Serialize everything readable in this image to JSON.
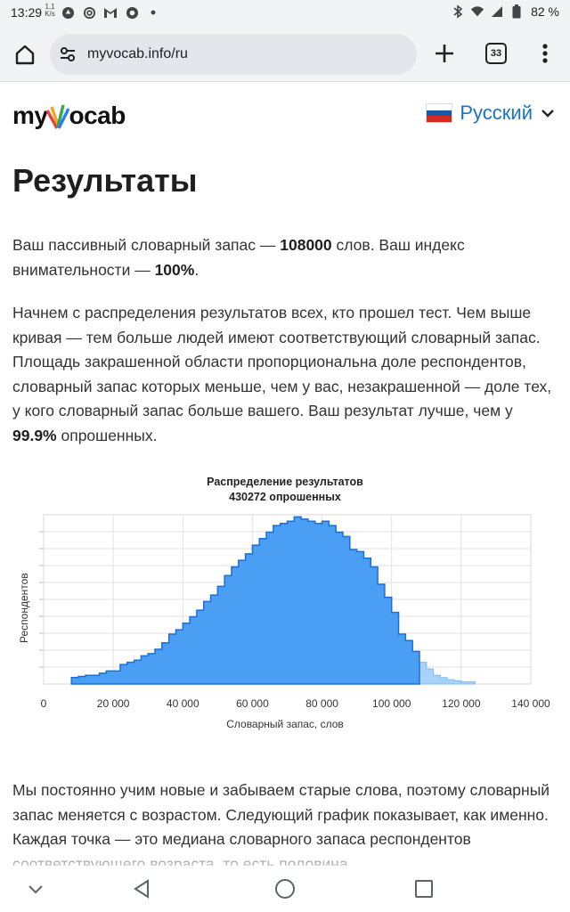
{
  "status_bar": {
    "time": "13:29",
    "speed_value": "1,1",
    "speed_unit": "K/s",
    "battery": "82 %",
    "icons": [
      "notification-icon",
      "at-icon",
      "gmail-icon",
      "chrome-icon",
      "dot-icon",
      "bluetooth-icon",
      "wifi-icon",
      "signal-icon",
      "battery-icon"
    ]
  },
  "browser": {
    "url": "myvocab.info/ru",
    "tab_count": "33"
  },
  "header": {
    "logo_prefix": "my",
    "logo_suffix": "ocab",
    "language": "Русский"
  },
  "page": {
    "title": "Результаты",
    "p1": {
      "t1": "Ваш пассивный словарный запас — ",
      "vocab": "108000",
      "t2": " слов. Ваш индекс внимательности — ",
      "attention": "100%",
      "t3": "."
    },
    "p2": {
      "t1": "Начнем с распределения результатов всех, кто прошел тест. Чем выше кривая — тем больше людей имеют соответствующий словарный запас. Площадь закрашенной области пропорциональна доле респондентов, словарный запас которых меньше, чем у вас, незакрашенной — доле тех, у кого словарный запас больше вашего. Ваш результат лучше, чем у ",
      "percent": "99.9%",
      "t2": " опрошенных."
    },
    "p3": "Мы постоянно учим новые и забываем старые слова, поэтому словарный запас меняется с возрастом. Следующий график показывает, как именно. Каждая точка — это медиана словарного запаса респондентов соответствующего возраста, то есть половина"
  },
  "chart_data": {
    "type": "area",
    "title": "Распределение результатов",
    "subtitle": "430272 опрошенных",
    "xlabel": "Словарный запас, слов",
    "ylabel": "Респондентов",
    "xlim": [
      0,
      140000
    ],
    "x_ticks": [
      "0",
      "20 000",
      "40 000",
      "60 000",
      "80 000",
      "100 000",
      "120 000",
      "140 000"
    ],
    "grid": true,
    "user_score": 108000,
    "colors": {
      "filled": "#4a9ff5",
      "filled_stroke": "#1a6fd6",
      "unfilled": "#a9d2fb"
    },
    "bin_width": 2000,
    "x": [
      8000,
      10000,
      12000,
      14000,
      16000,
      18000,
      20000,
      22000,
      24000,
      26000,
      28000,
      30000,
      32000,
      34000,
      36000,
      38000,
      40000,
      42000,
      44000,
      46000,
      48000,
      50000,
      52000,
      54000,
      56000,
      58000,
      60000,
      62000,
      64000,
      66000,
      68000,
      70000,
      72000,
      74000,
      76000,
      78000,
      80000,
      82000,
      84000,
      86000,
      88000,
      90000,
      92000,
      94000,
      96000,
      98000,
      100000,
      102000,
      104000,
      106000,
      108000,
      110000,
      112000,
      114000,
      116000,
      118000,
      120000,
      122000
    ],
    "values": [
      3,
      3.5,
      4,
      4,
      5,
      6,
      6,
      9,
      10,
      11,
      13,
      14,
      16,
      19,
      23,
      25,
      28,
      31,
      34,
      38,
      41,
      45,
      50,
      54,
      57,
      60,
      64,
      67,
      70,
      73,
      74,
      75,
      77,
      76,
      75,
      74,
      75,
      73,
      70,
      68,
      62,
      61,
      58,
      54,
      46,
      40,
      33,
      23,
      20,
      15,
      10,
      7,
      4,
      3,
      2,
      1.5,
      1,
      1
    ]
  }
}
